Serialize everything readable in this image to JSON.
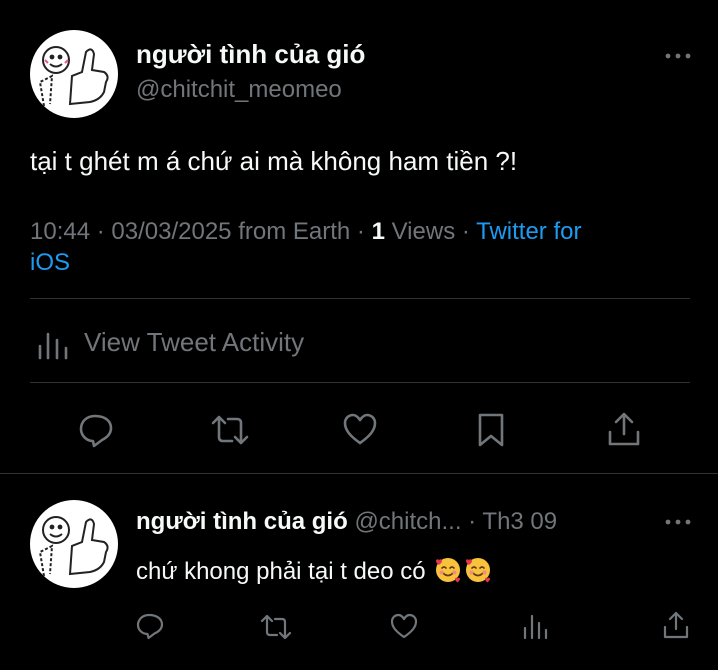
{
  "tweet": {
    "display_name": "người tình của gió",
    "handle": "@chitchit_meomeo",
    "text": "tại t ghét m á chứ ai mà không ham tiền ?!",
    "time": "10:44",
    "sep1": "·",
    "date": "03/03/2025",
    "location": "from Earth",
    "sep2": "·",
    "views_count": "1",
    "views_label": "Views",
    "sep3": "·",
    "client_line1": "Twitter for",
    "client_line2": "iOS",
    "activity_label": "View Tweet Activity",
    "more_icon": "more-horizontal-icon",
    "actions": [
      "reply-icon",
      "retweet-icon",
      "like-icon",
      "bookmark-icon",
      "share-icon"
    ]
  },
  "reply": {
    "display_name": "người tình của gió",
    "handle": "@chitch...",
    "sep": "·",
    "date": "Th3 09",
    "text": "chứ khong phải tại t deo có",
    "emoji": [
      "smiling-face-with-hearts",
      "smiling-face-with-hearts"
    ],
    "more_icon": "more-horizontal-icon",
    "actions": [
      "reply-icon",
      "retweet-icon",
      "like-icon",
      "views-icon",
      "share-icon"
    ]
  },
  "colors": {
    "background": "#000000",
    "text": "#e7e9ea",
    "muted": "#71767b",
    "link": "#1d9bf0",
    "divider": "#2f3336"
  }
}
